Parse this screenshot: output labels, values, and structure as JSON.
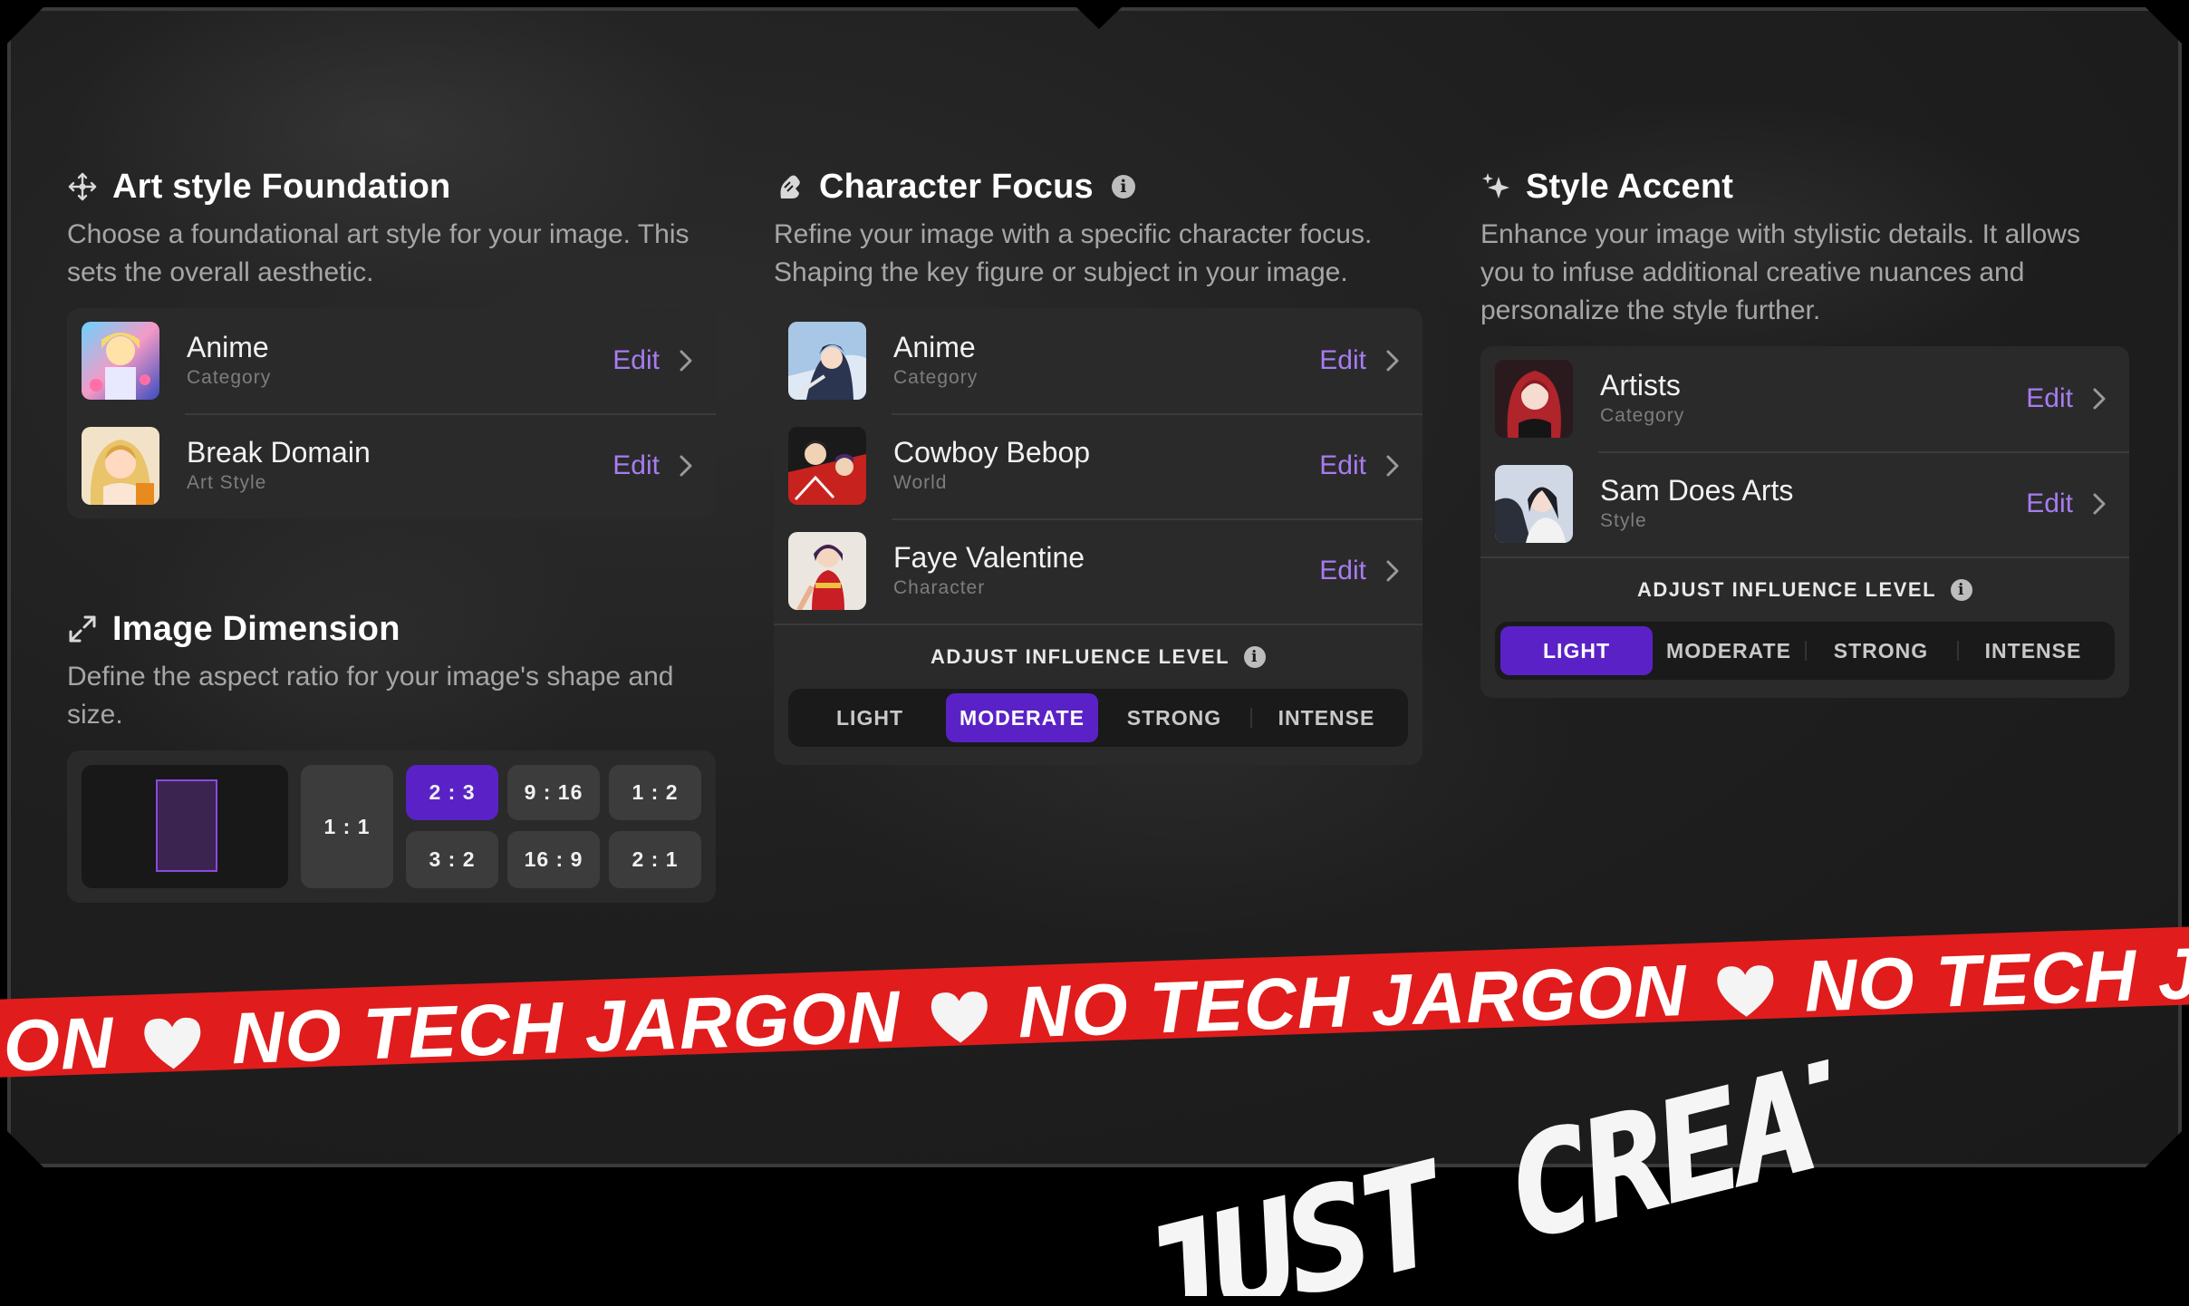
{
  "sections": {
    "art_style": {
      "title": "Art style Foundation",
      "description": "Choose a foundational art style for your image. This sets the overall aesthetic.",
      "items": [
        {
          "title": "Anime",
          "subtitle": "Category",
          "edit": "Edit"
        },
        {
          "title": "Break Domain",
          "subtitle": "Art Style",
          "edit": "Edit"
        }
      ]
    },
    "character": {
      "title": "Character Focus",
      "info": "i",
      "description": "Refine your image with a specific character focus. Shaping the key figure or subject in your image.",
      "items": [
        {
          "title": "Anime",
          "subtitle": "Category",
          "edit": "Edit"
        },
        {
          "title": "Cowboy Bebop",
          "subtitle": "World",
          "edit": "Edit"
        },
        {
          "title": "Faye Valentine",
          "subtitle": "Character",
          "edit": "Edit"
        }
      ],
      "influence": {
        "label": "ADJUST INFLUENCE LEVEL",
        "options": [
          "LIGHT",
          "MODERATE",
          "STRONG",
          "INTENSE"
        ],
        "selected": "MODERATE"
      }
    },
    "accent": {
      "title": "Style Accent",
      "description": "Enhance your image with stylistic details. It allows you to infuse additional creative nuances and personalize the style further.",
      "items": [
        {
          "title": "Artists",
          "subtitle": "Category",
          "edit": "Edit"
        },
        {
          "title": "Sam Does Arts",
          "subtitle": "Style",
          "edit": "Edit"
        }
      ],
      "influence": {
        "label": "ADJUST INFLUENCE LEVEL",
        "options": [
          "LIGHT",
          "MODERATE",
          "STRONG",
          "INTENSE"
        ],
        "selected": "LIGHT"
      }
    },
    "dimension": {
      "title": "Image Dimension",
      "description": "Define the aspect ratio for your image's shape and size.",
      "ratios": [
        "1 : 1",
        "2 : 3",
        "9 : 16",
        "1 : 2",
        "3 : 2",
        "16 : 9",
        "2 : 1"
      ],
      "selected": "2 : 3"
    }
  },
  "banner": {
    "segments": [
      "RGON",
      "NO TECH JARGON",
      "NO TECH JARGON",
      "NO TECH JARGON"
    ]
  },
  "tagline": "JUST CREATIVITY",
  "colors": {
    "accent": "#5a22c6",
    "edit_link": "#a77cf0",
    "banner": "#e01c1c",
    "panel": "#2a2a2a"
  },
  "icons": {
    "art_style": "move-arrows-icon",
    "character": "brush-hand-icon",
    "accent": "sparkle-icon",
    "dimension": "expand-diagonal-icon",
    "chevron": "chevron-right-icon",
    "heart": "heart-icon"
  }
}
